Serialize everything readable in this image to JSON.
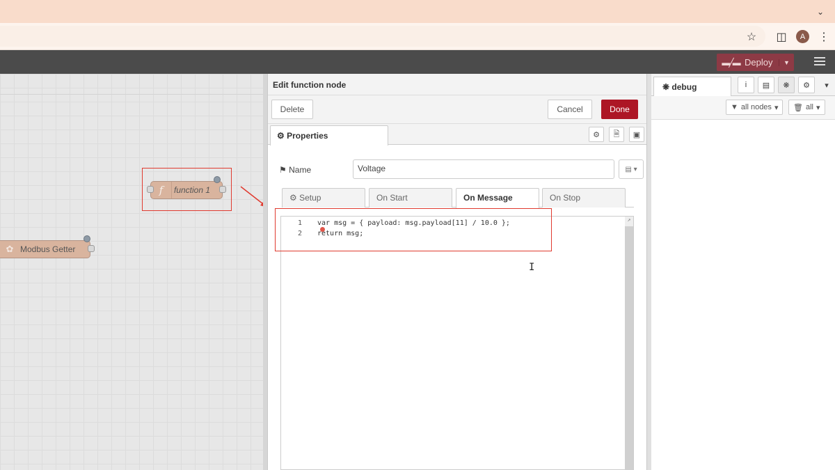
{
  "browser": {
    "tab_menu_icon": "chevron-down-icon",
    "avatar_letter": "A"
  },
  "header": {
    "deploy_label": "Deploy"
  },
  "workspace": {
    "function_node_label": "function 1",
    "function_node_icon": "f",
    "modbus_node_label": "Modbus Getter"
  },
  "tray": {
    "title": "Edit function node",
    "delete_label": "Delete",
    "cancel_label": "Cancel",
    "done_label": "Done",
    "properties_tab": "Properties",
    "name_label": "Name",
    "name_value": "Voltage",
    "code_tabs": [
      "Setup",
      "On Start",
      "On Message",
      "On Stop"
    ],
    "active_code_tab": "On Message",
    "code_lines": [
      {
        "num": "1",
        "text": "var msg = { payload: msg.payload[11] / 10.0 };"
      },
      {
        "num": "2",
        "text": "return msg;"
      }
    ]
  },
  "sidebar": {
    "tab_label": "debug",
    "filter_label": "all nodes",
    "clear_label": "all"
  },
  "colors": {
    "deploy": "#8d3a45",
    "done": "#ad1625",
    "highlight": "#e03a2f",
    "node": "#d9b49e"
  }
}
